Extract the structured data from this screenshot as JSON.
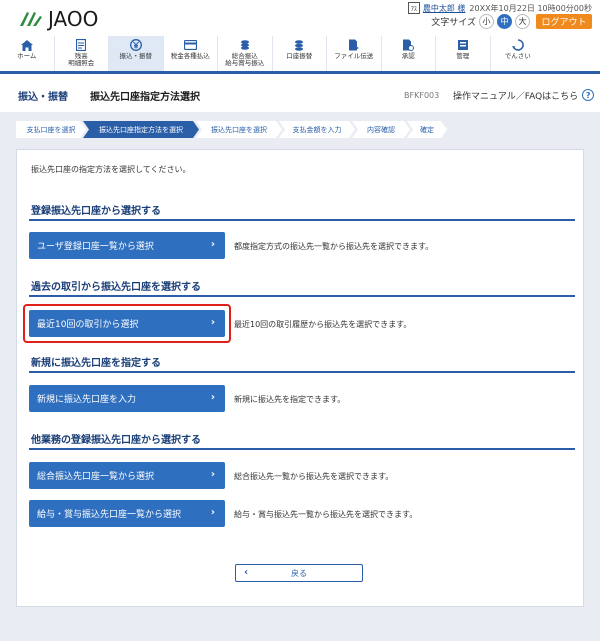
{
  "header": {
    "logo_text": "JAOO",
    "user_badge": "ｱｽ",
    "user_name": "農中太郎 様",
    "datetime": "20XX年10月22日 10時00分00秒",
    "font_size_label": "文字サイズ",
    "font_sizes": [
      "小",
      "中",
      "大"
    ],
    "logout_label": "ログアウト"
  },
  "nav": {
    "items": [
      {
        "label": "ホーム",
        "icon": "home-icon"
      },
      {
        "label": "残高\n明細照会",
        "icon": "document-icon"
      },
      {
        "label": "振込・振替",
        "icon": "yen-icon"
      },
      {
        "label": "税金各種払込",
        "icon": "card-icon"
      },
      {
        "label": "総合振込\n給与賞与振込",
        "icon": "coins-icon"
      },
      {
        "label": "口座振替",
        "icon": "coins-stack-icon"
      },
      {
        "label": "ファイル伝送",
        "icon": "file-transfer-icon"
      },
      {
        "label": "承認",
        "icon": "approval-icon"
      },
      {
        "label": "管理",
        "icon": "admin-icon"
      },
      {
        "label": "でんさい",
        "icon": "densai-icon"
      }
    ]
  },
  "titlebar": {
    "section": "振込・振替",
    "title": "振込先口座指定方法選択",
    "screen_code": "BFKF003",
    "help_text": "操作マニュアル／FAQはこちら",
    "help_icon_glyph": "?"
  },
  "steps": [
    "支払口座を選択",
    "振込先口座指定方法を選択",
    "振込先口座を選択",
    "支払金額を入力",
    "内容確認",
    "確定"
  ],
  "main": {
    "intro": "振込先口座の指定方法を選択してください。",
    "sections": [
      {
        "title": "登録振込先口座から選択する",
        "buttons": [
          {
            "label": "ユーザ登録口座一覧から選択",
            "desc": "都度指定方式の振込先一覧から振込先を選択できます。"
          }
        ]
      },
      {
        "title": "過去の取引から振込先口座を選択する",
        "buttons": [
          {
            "label": "最近10回の取引から選択",
            "desc": "最近10回の取引履歴から振込先を選択できます。"
          }
        ]
      },
      {
        "title": "新規に振込先口座を指定する",
        "buttons": [
          {
            "label": "新規に振込先口座を入力",
            "desc": "新規に振込先を指定できます。"
          }
        ]
      },
      {
        "title": "他業務の登録振込先口座から選択する",
        "buttons": [
          {
            "label": "総合振込先口座一覧から選択",
            "desc": "総合振込先一覧から振込先を選択できます。"
          },
          {
            "label": "給与・賞与振込先口座一覧から選択",
            "desc": "給与・賞与振込先一覧から振込先を選択できます。"
          }
        ]
      }
    ],
    "back_label": "戻る"
  },
  "colors": {
    "primary": "#2f6fbf",
    "header_blue": "#2a5fa8",
    "title_navy": "#1a3e78",
    "logout_orange": "#f08a1c",
    "highlight_red": "#e0201a",
    "background_gray": "#e9edf3"
  }
}
